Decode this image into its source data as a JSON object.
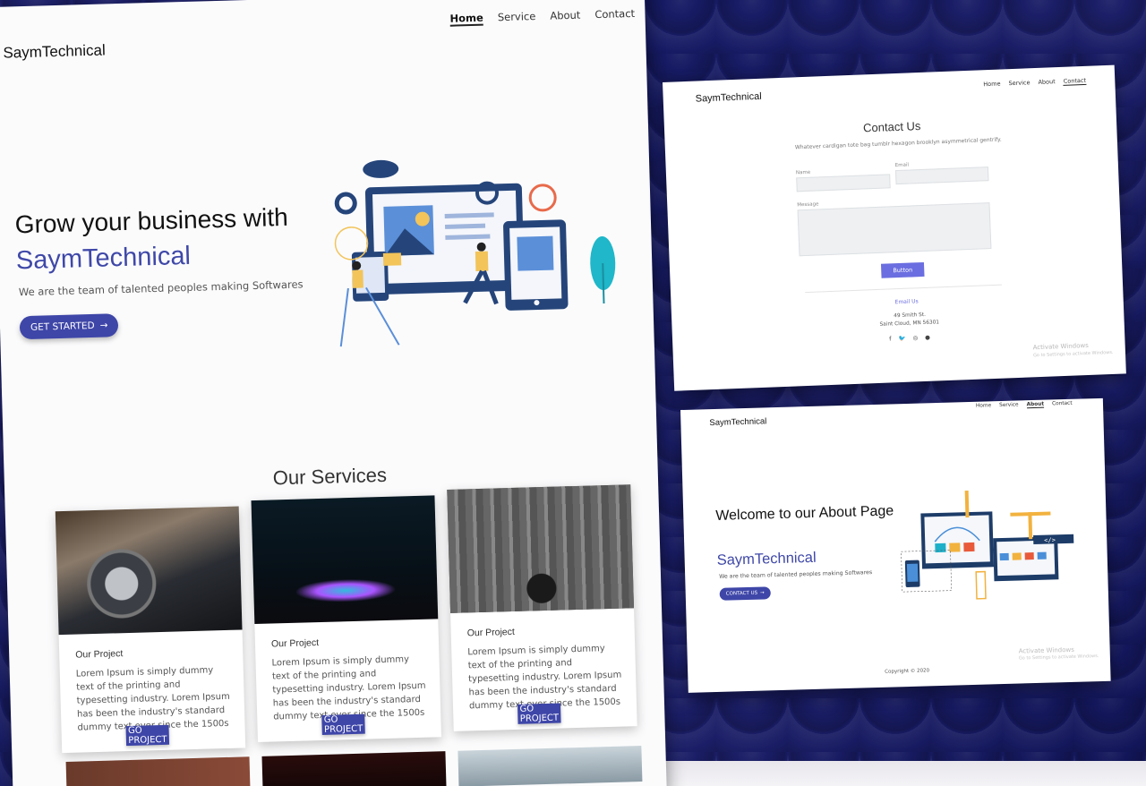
{
  "main": {
    "logo": "SaymTechnical",
    "nav": [
      "Home",
      "Service",
      "About",
      "Contact"
    ],
    "hero_title": "Grow your business with",
    "hero_brand": "SaymTechnical",
    "hero_sub": "We are the team of talented peoples making Softwares",
    "cta": "GET STARTED",
    "services_title": "Our Services",
    "cards": [
      {
        "title": "Our Project",
        "text": "Lorem Ipsum is simply dummy text of the printing and typesetting industry. Lorem Ipsum has been the industry's standard dummy text ever since the 1500s",
        "button": "GO PROJECT"
      },
      {
        "title": "Our Project",
        "text": "Lorem Ipsum is simply dummy text of the printing and typesetting industry. Lorem Ipsum has been the industry's standard dummy text ever since the 1500s",
        "button": "GO PROJECT"
      },
      {
        "title": "Our Project",
        "text": "Lorem Ipsum is simply dummy text of the printing and typesetting industry. Lorem Ipsum has been the industry's standard dummy text ever since the 1500s",
        "button": "GO PROJECT"
      }
    ]
  },
  "contact": {
    "logo": "SaymTechnical",
    "nav": [
      "Home",
      "Service",
      "About",
      "Contact"
    ],
    "title": "Contact Us",
    "subtitle": "Whatever cardigan tote bag tumblr hexagon brooklyn asymmetrical gentrify.",
    "name_label": "Name",
    "email_label": "Email",
    "message_label": "Message",
    "button": "Button",
    "email_link": "Email Us",
    "address_line1": "49 Smith St.",
    "address_line2": "Saint Cloud, MN 56301",
    "social": [
      "f",
      "t",
      "ig",
      "chat"
    ],
    "watermark_title": "Activate Windows",
    "watermark_sub": "Go to Settings to activate Windows."
  },
  "about": {
    "logo": "SaymTechnical",
    "nav": [
      "Home",
      "Service",
      "About",
      "Contact"
    ],
    "title": "Welcome to our About Page",
    "brand": "SaymTechnical",
    "sub": "We are the team of talented peoples making Softwares",
    "cta": "CONTACT US",
    "copyright": "Copyright © 2020",
    "watermark_title": "Activate Windows",
    "watermark_sub": "Go to Settings to activate Windows."
  },
  "colors": {
    "brand": "#3f48a8",
    "contact_button": "#6b6ee0",
    "background": "#1c1f6b"
  }
}
